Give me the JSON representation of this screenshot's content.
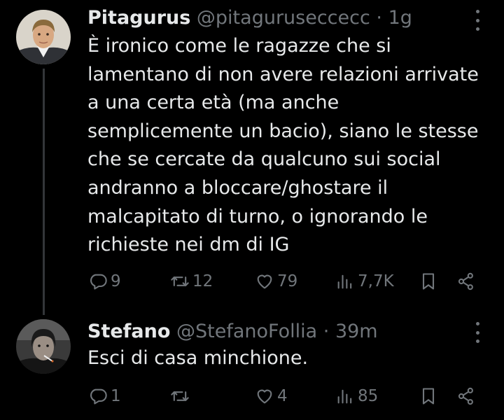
{
  "tweets": [
    {
      "name": "Pitagurus",
      "handle": "@pitaguruseccecc",
      "separator": "·",
      "time": "1g",
      "text": "È ironico come le ragazze che si\nlamentano di non avere relazioni arrivate\na una certa età (ma anche\nsemplicemente un bacio), siano le stesse\nche se cercate da qualcuno sui social\nandranno a bloccare/ghostare il\nmalcapitato di turno, o ignorando le\nrichieste nei dm di IG",
      "replies": "9",
      "retweets": "12",
      "likes": "79",
      "views": "7,7K"
    },
    {
      "name": "Stefano",
      "handle": "@StefanoFollia",
      "separator": "·",
      "time": "39m",
      "text": "Esci di casa minchione.",
      "replies": "1",
      "retweets": "",
      "likes": "4",
      "views": "85"
    }
  ],
  "colors": {
    "background": "#000000",
    "text": "#e7e9ea",
    "muted": "#71767b",
    "thread_line": "#333639"
  },
  "icons": [
    "reply-icon",
    "retweet-icon",
    "like-icon",
    "views-icon",
    "bookmark-icon",
    "share-icon",
    "more-icon"
  ]
}
